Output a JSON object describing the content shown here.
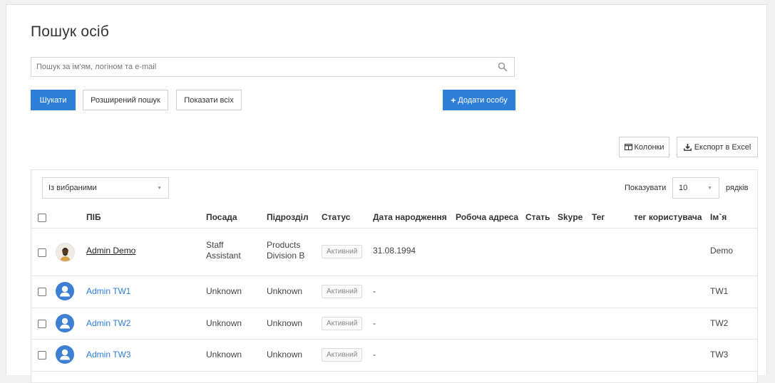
{
  "page": {
    "title": "Пошук осіб"
  },
  "search": {
    "placeholder": "Пошук за ім'ям, логіном та e-mail",
    "value": ""
  },
  "buttons": {
    "search": "Шукати",
    "advanced": "Розширений пошук",
    "show_all": "Показати всіх",
    "add_person": "Додати особу",
    "columns": "Колонки",
    "export": "Експорт в Excel"
  },
  "table_controls": {
    "bulk_action": "Із вибраними",
    "show_label": "Показувати",
    "page_size": "10",
    "rows_label": "рядків"
  },
  "columns": {
    "name": "ПІБ",
    "position": "Посада",
    "department": "Підрозділ",
    "status": "Статус",
    "birth_date": "Дата народження",
    "work_address": "Робоча адреса",
    "gender": "Стать",
    "skype": "Skype",
    "tag": "Тег",
    "user_tag": "тег користувача",
    "first_name": "Ім`я"
  },
  "rows": [
    {
      "name": "Admin Demo",
      "position": [
        "Staff",
        "Assistant"
      ],
      "department": [
        "Products",
        "Division B"
      ],
      "status": "Активний",
      "birth_date": "31.08.1994",
      "first_name": "Demo",
      "avatar": "photo"
    },
    {
      "name": "Admin TW1",
      "position": [
        "Unknown"
      ],
      "department": [
        "Unknown"
      ],
      "status": "Активний",
      "birth_date": "-",
      "first_name": "TW1",
      "avatar": "default"
    },
    {
      "name": "Admin TW2",
      "position": [
        "Unknown"
      ],
      "department": [
        "Unknown"
      ],
      "status": "Активний",
      "birth_date": "-",
      "first_name": "TW2",
      "avatar": "default"
    },
    {
      "name": "Admin TW3",
      "position": [
        "Unknown"
      ],
      "department": [
        "Unknown"
      ],
      "status": "Активний",
      "birth_date": "-",
      "first_name": "TW3",
      "avatar": "default"
    }
  ],
  "colors": {
    "primary": "#2d7fd8",
    "link": "#2d7fd8"
  }
}
